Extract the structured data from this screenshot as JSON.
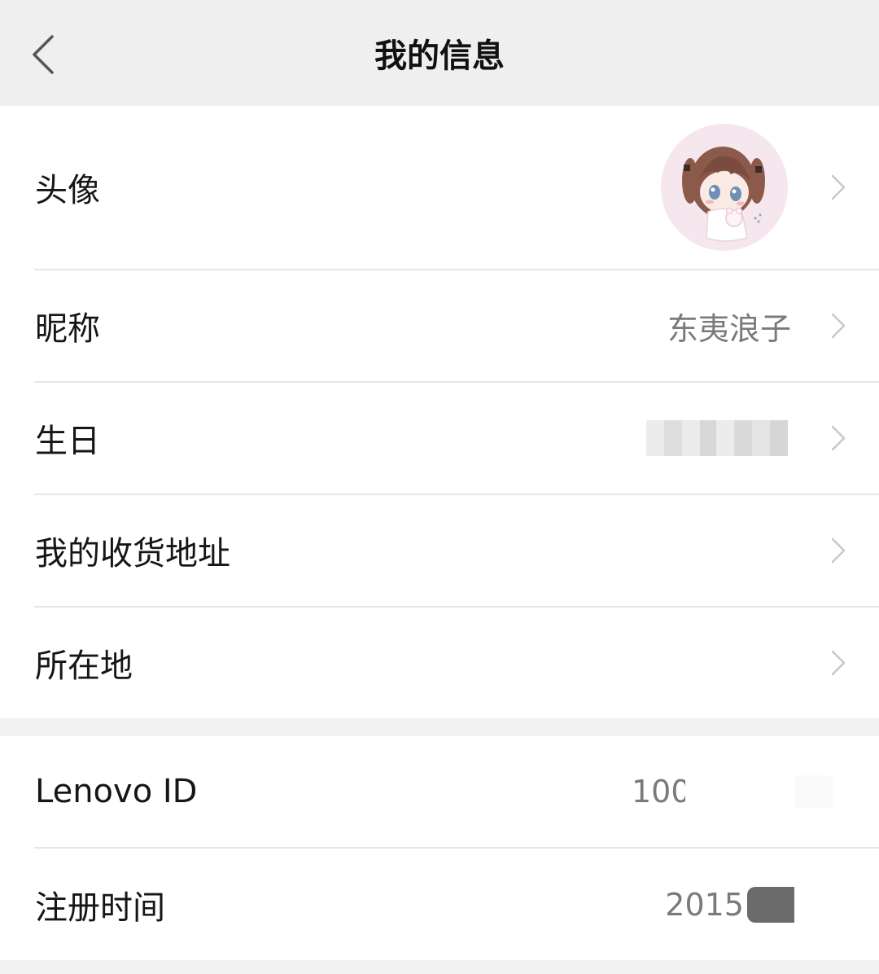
{
  "header": {
    "title": "我的信息",
    "back_icon": "chevron-left-icon"
  },
  "profile_section": {
    "avatar_row": {
      "label": "头像",
      "chevron_icon": "chevron-right-icon"
    },
    "nickname_row": {
      "label": "昵称",
      "value": "东夷浪子",
      "chevron_icon": "chevron-right-icon"
    },
    "birthday_row": {
      "label": "生日",
      "chevron_icon": "chevron-right-icon"
    },
    "address_row": {
      "label": "我的收货地址",
      "chevron_icon": "chevron-right-icon"
    },
    "location_row": {
      "label": "所在地",
      "chevron_icon": "chevron-right-icon"
    }
  },
  "account_section": {
    "lenovo_id_row": {
      "label": "Lenovo ID",
      "value": "100"
    },
    "register_time_row": {
      "label": "注册时间",
      "value": "2015"
    }
  },
  "colors": {
    "header_bg": "#efefef",
    "page_bg": "#f2f2f2",
    "row_bg": "#ffffff",
    "label_text": "#161616",
    "value_text": "#7a7a7a",
    "chevron": "#c8c8c8",
    "divider": "#e6e6e6"
  }
}
